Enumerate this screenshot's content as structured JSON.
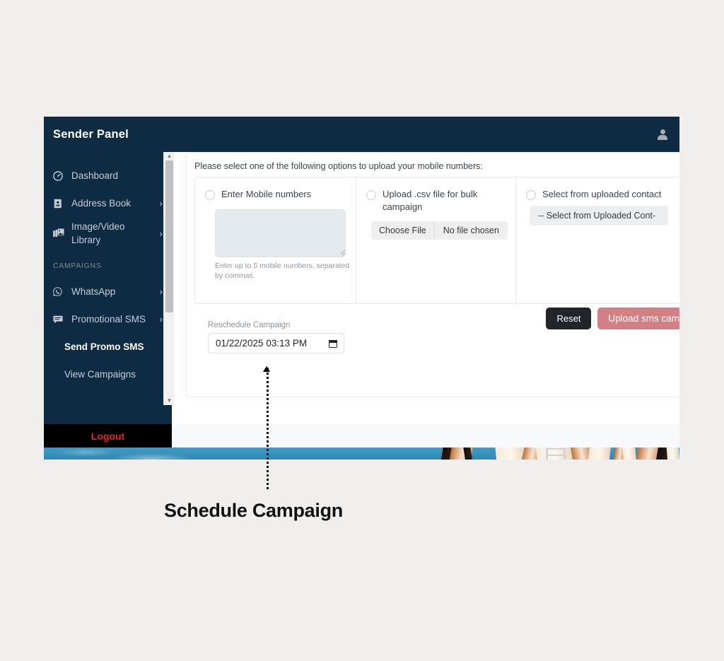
{
  "header": {
    "title": "Sender Panel",
    "avatar_icon": "user-icon"
  },
  "sidebar": {
    "items": [
      {
        "label": "Dashboard",
        "icon": "speedometer-icon",
        "caret": "",
        "type": "top"
      },
      {
        "label": "Address Book",
        "icon": "address-book-icon",
        "caret": "›",
        "type": "top"
      },
      {
        "label": "Image/Video Library",
        "icon": "photo-library-icon",
        "caret": "›",
        "type": "top"
      }
    ],
    "section_label": "CAMPAIGNS",
    "campaign_items": [
      {
        "label": "WhatsApp",
        "icon": "whatsapp-icon",
        "caret": "›",
        "type": "top"
      },
      {
        "label": "Promotional SMS",
        "icon": "chat-bubble-icon",
        "caret": "›",
        "type": "top"
      },
      {
        "label": "Send Promo SMS",
        "icon": "",
        "caret": "",
        "type": "sub",
        "active": true
      },
      {
        "label": "View Campaigns",
        "icon": "",
        "caret": "",
        "type": "sub",
        "active": false
      }
    ],
    "logout_label": "Logout",
    "logout_color": "#e8271e"
  },
  "main": {
    "instruction": "Please select one of the following options to upload your mobile numbers:",
    "options": [
      {
        "radio_label": "Enter Mobile numbers",
        "textarea_value": "",
        "help_text": "Enter up to 5 mobile numbers, separated by commas."
      },
      {
        "radio_label": "Upload .csv file for bulk campaign",
        "choose_file_label": "Choose File",
        "file_chosen_label": "No file chosen"
      },
      {
        "radio_label": "Select from uploaded contact",
        "select_value": "-- Select from Uploaded Cont-"
      }
    ],
    "reschedule_label": "Reschedule Campaign",
    "datetime_value": "01/22/2025 03:13 PM",
    "calendar_icon": "calendar-icon",
    "reset_label": "Reset",
    "upload_label": "Upload sms campaign",
    "reset_color": "#212529",
    "upload_color": "#d28084"
  },
  "annotation": {
    "label": "Schedule Campaign"
  }
}
